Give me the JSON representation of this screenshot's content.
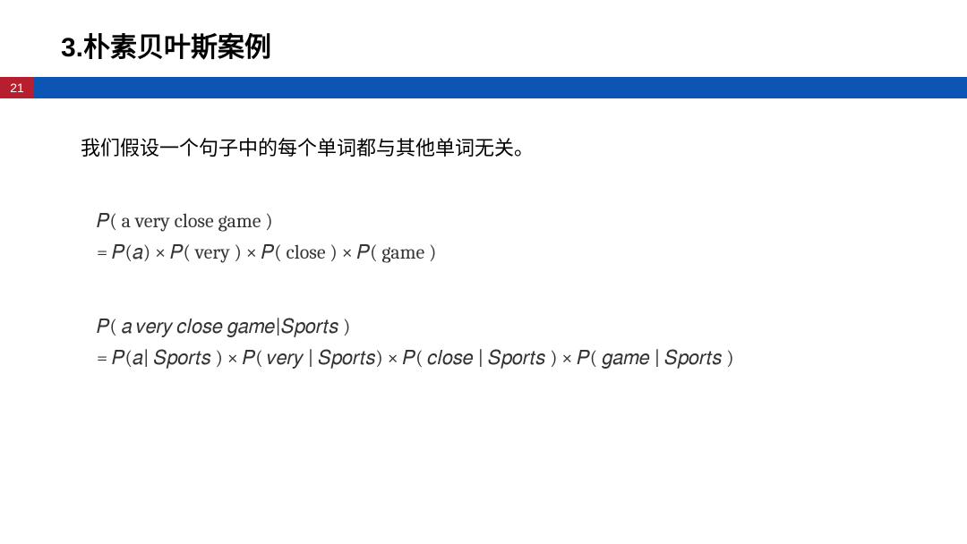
{
  "heading": "3.朴素贝叶斯案例",
  "page_number": "21",
  "intro_text": "我们假设一个句子中的每个单词都与其他单词无关。",
  "formula1_line1": "𝑃( a very close game )",
  "formula1_line2": "= 𝑃(𝑎) × 𝑃( very ) × 𝑃( close ) × 𝑃( game )",
  "formula2_line1": "𝑃( 𝑎 𝑣𝑒𝑟𝑦 𝑐𝑙𝑜𝑠𝑒 𝑔𝑎𝑚𝑒|𝑆𝑝𝑜𝑟𝑡𝑠 )",
  "formula2_line2": "= 𝑃(𝑎| 𝑆𝑝𝑜𝑟𝑡𝑠 ) × 𝑃( 𝑣𝑒𝑟𝑦 | 𝑆𝑝𝑜𝑟𝑡𝑠) × 𝑃( 𝑐𝑙𝑜𝑠𝑒 | 𝑆𝑝𝑜𝑟𝑡𝑠 ) × 𝑃( 𝑔𝑎𝑚𝑒 | 𝑆𝑝𝑜𝑟𝑡𝑠 )"
}
